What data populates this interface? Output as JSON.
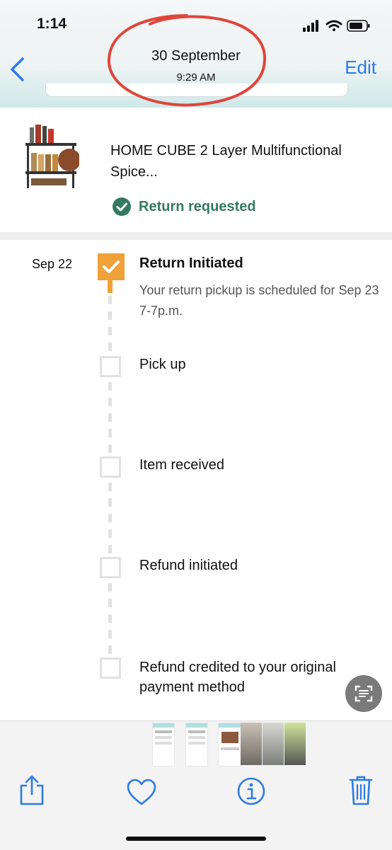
{
  "status_bar": {
    "time": "1:14"
  },
  "nav": {
    "title": "30 September",
    "subtitle": "9:29 AM",
    "edit_label": "Edit"
  },
  "product": {
    "name": "HOME CUBE 2 Layer Multifunctional Spice...",
    "status": "Return requested",
    "status_color": "#347a63"
  },
  "timeline": {
    "date": "Sep 22",
    "steps": [
      {
        "title": "Return Initiated",
        "description": "Your return pickup is scheduled for Sep 23 7-7p.m.",
        "done": true
      },
      {
        "title": "Pick up",
        "done": false
      },
      {
        "title": "Item received",
        "done": false
      },
      {
        "title": "Refund initiated",
        "done": false
      },
      {
        "title": "Refund credited to your original payment method",
        "done": false
      }
    ]
  },
  "colors": {
    "accent": "#2c7be5",
    "step_done": "#f0a138",
    "annotation": "#e0453a"
  },
  "toolbar": {
    "icons": [
      "share-icon",
      "heart-icon",
      "info-icon",
      "trash-icon"
    ]
  }
}
